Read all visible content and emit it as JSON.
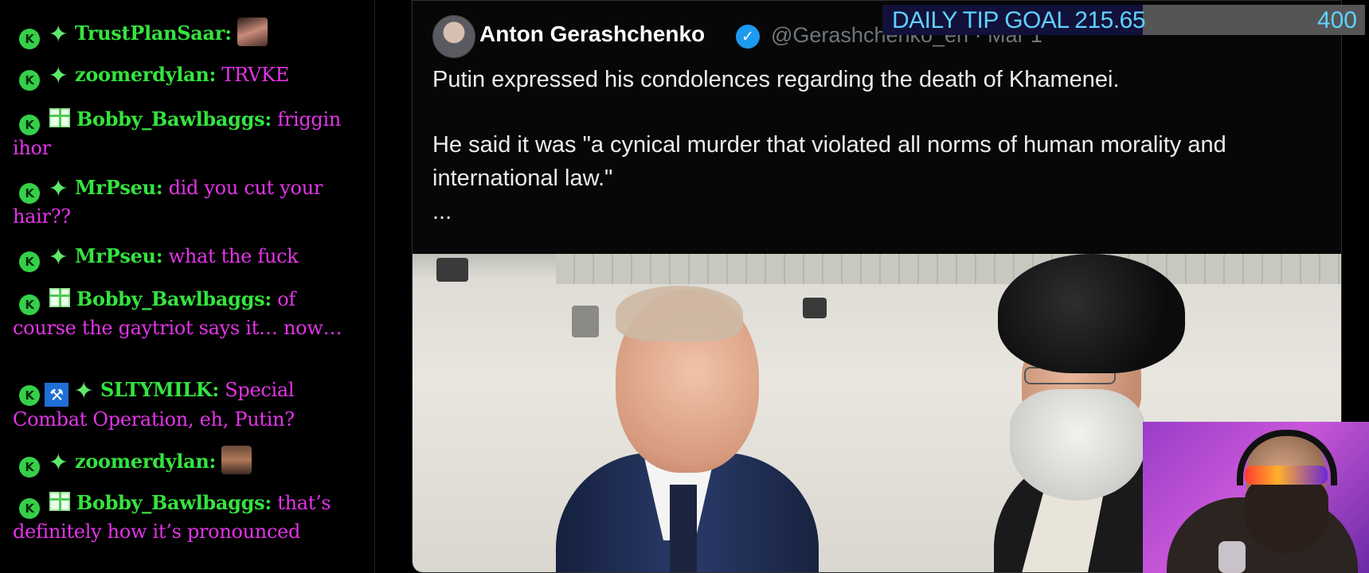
{
  "chat": {
    "messages": [
      {
        "badge": "K",
        "icon": "sparkle",
        "username": "TrustPlanSaar:",
        "text": "",
        "emote": "goat"
      },
      {
        "badge": "K",
        "icon": "sparkle",
        "username": "zoomerdylan:",
        "text": "TRVKE"
      },
      {
        "badge": "K",
        "icon": "gift",
        "username": "Bobby_Bawlbaggs:",
        "text": "friggin ihor"
      },
      {
        "badge": "K",
        "icon": "sparkle",
        "username": "MrPseu:",
        "text": "did you cut your hair??"
      },
      {
        "badge": "K",
        "icon": "sparkle",
        "username": "MrPseu:",
        "text": "what the fuck"
      },
      {
        "badge": "K",
        "icon": "gift",
        "username": "Bobby_Bawlbaggs:",
        "text": "of course the gaytriot says it… now…"
      },
      {
        "badge": "K",
        "icon": "mod-sparkle",
        "username": "SLTYMILK:",
        "text": "Special Combat Operation, eh, Putin?"
      },
      {
        "badge": "K",
        "icon": "sparkle",
        "username": "zoomerdylan:",
        "text": "",
        "emote": "face"
      },
      {
        "badge": "K",
        "icon": "gift",
        "username": "Bobby_Bawlbaggs:",
        "text": "that’s definitely how it’s pronounced"
      }
    ],
    "colors": {
      "username": "#35e33f",
      "text": "#e434e8"
    }
  },
  "tweet": {
    "author_name": "Anton Gerashchenko",
    "handle": "@Gerashchenko_en · Mar 1",
    "line1": "Putin expressed his condolences regarding the death of Khamenei.",
    "line2": "He said it was \"a cynical murder that violated all norms of human morality and",
    "line3": "international law.\"",
    "more": "...",
    "verified_color": "#1d9bf0"
  },
  "tip_goal": {
    "label": "DAILY TIP GOAL 215.65",
    "current": 215.65,
    "target": "400",
    "progress": 0.539,
    "color": "#5ed2ff"
  },
  "webcam": {
    "background": "#b04bd0"
  }
}
